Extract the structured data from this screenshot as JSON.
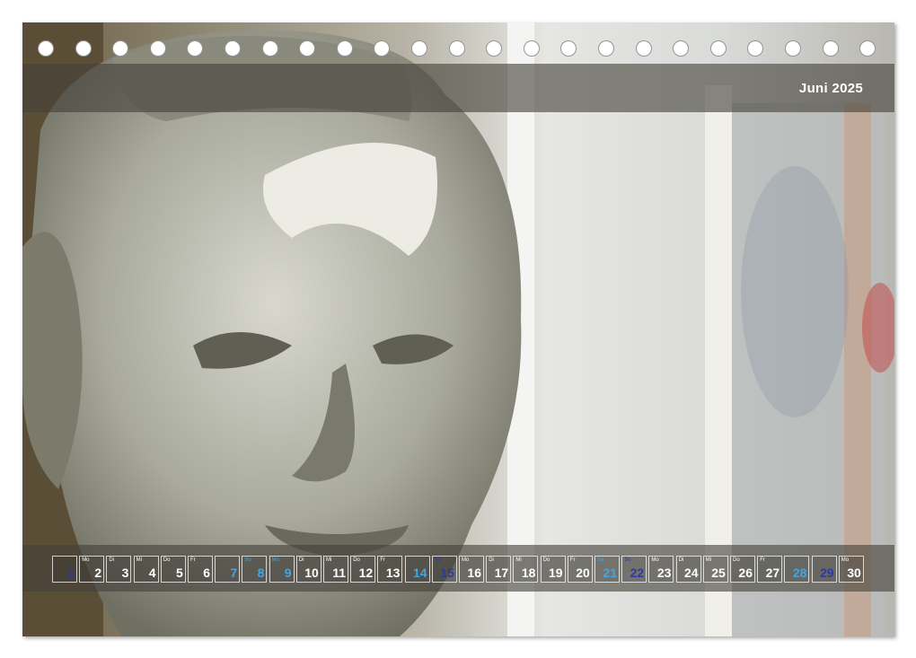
{
  "calendar": {
    "month_label": "Juni 2025",
    "days": [
      {
        "wd": "",
        "num": "1",
        "type": "sun"
      },
      {
        "wd": "Mo",
        "num": "2",
        "type": "week"
      },
      {
        "wd": "Di",
        "num": "3",
        "type": "week"
      },
      {
        "wd": "Mi",
        "num": "4",
        "type": "week"
      },
      {
        "wd": "Do",
        "num": "5",
        "type": "week"
      },
      {
        "wd": "Fr",
        "num": "6",
        "type": "week"
      },
      {
        "wd": "",
        "num": "7",
        "type": "sat"
      },
      {
        "wd": "So",
        "num": "8",
        "type": "sat"
      },
      {
        "wd": "Mo",
        "num": "9",
        "type": "sat"
      },
      {
        "wd": "Di",
        "num": "10",
        "type": "week"
      },
      {
        "wd": "Mi",
        "num": "11",
        "type": "week"
      },
      {
        "wd": "Do",
        "num": "12",
        "type": "week"
      },
      {
        "wd": "Fr",
        "num": "13",
        "type": "week"
      },
      {
        "wd": "",
        "num": "14",
        "type": "sat"
      },
      {
        "wd": "So",
        "num": "15",
        "type": "sun"
      },
      {
        "wd": "Mo",
        "num": "16",
        "type": "week"
      },
      {
        "wd": "Di",
        "num": "17",
        "type": "week"
      },
      {
        "wd": "Mi",
        "num": "18",
        "type": "week"
      },
      {
        "wd": "Do",
        "num": "19",
        "type": "week"
      },
      {
        "wd": "Fr",
        "num": "20",
        "type": "week"
      },
      {
        "wd": "Sa",
        "num": "21",
        "type": "sat"
      },
      {
        "wd": "So",
        "num": "22",
        "type": "sun"
      },
      {
        "wd": "Mo",
        "num": "23",
        "type": "week"
      },
      {
        "wd": "Di",
        "num": "24",
        "type": "week"
      },
      {
        "wd": "Mi",
        "num": "25",
        "type": "week"
      },
      {
        "wd": "Do",
        "num": "26",
        "type": "week"
      },
      {
        "wd": "Fr",
        "num": "27",
        "type": "week"
      },
      {
        "wd": "",
        "num": "28",
        "type": "sat"
      },
      {
        "wd": "",
        "num": "29",
        "type": "sun"
      },
      {
        "wd": "Mo",
        "num": "30",
        "type": "week"
      }
    ]
  },
  "binding": {
    "hole_count": 23
  },
  "colors": {
    "band": "#46423a",
    "saturday": "#4aa3df",
    "sunday": "#2f3a9a"
  }
}
